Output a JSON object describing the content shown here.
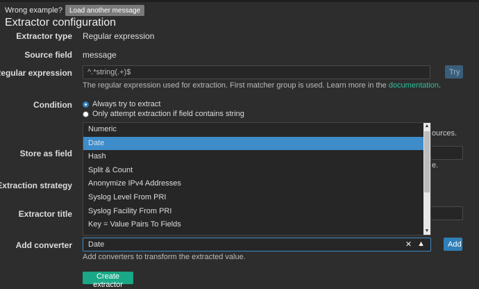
{
  "top": {
    "wrong_example": "Wrong example?",
    "load_another": "Load another message"
  },
  "page_title": "Extractor configuration",
  "fields": {
    "extractor_type": {
      "label": "Extractor type",
      "value": "Regular expression"
    },
    "source_field": {
      "label": "Source field",
      "value": "message"
    },
    "regex": {
      "label": "Regular expression",
      "value": "^.*string(.+)$",
      "try_label": "Try",
      "help": "The regular expression used for extraction. First matcher group is used. Learn more in the",
      "help_link": "documentation",
      "help_end": "."
    },
    "condition": {
      "label": "Condition",
      "options": [
        {
          "label": "Always try to extract",
          "checked": true
        },
        {
          "label": "Only attempt extraction if field contains string",
          "checked": false
        }
      ]
    },
    "store_as": {
      "label": "Store as field"
    },
    "strategy": {
      "label": "Extraction strategy"
    },
    "title": {
      "label": "Extractor title"
    },
    "converter": {
      "label": "Add converter",
      "selected": "Date",
      "add_label": "Add",
      "help": "Add converters to transform the extracted value."
    }
  },
  "truncated": {
    "sources": "ources.",
    "field_hint": "e."
  },
  "dropdown": {
    "items": [
      {
        "label": "Numeric",
        "selected": false
      },
      {
        "label": "Date",
        "selected": true
      },
      {
        "label": "Hash",
        "selected": false
      },
      {
        "label": "Split & Count",
        "selected": false
      },
      {
        "label": "Anonymize IPv4 Addresses",
        "selected": false
      },
      {
        "label": "Syslog Level From PRI",
        "selected": false
      },
      {
        "label": "Syslog Facility From PRI",
        "selected": false
      },
      {
        "label": "Key = Value Pairs To Fields",
        "selected": false
      }
    ]
  },
  "create_label": "Create extractor",
  "icons": {
    "clear": "close-icon",
    "caret": "caret-up-icon"
  },
  "colors": {
    "accent": "#2f7fb8",
    "link": "#2fc09d",
    "create": "#1aa886",
    "dropdown_selected": "#3e8cc9"
  }
}
